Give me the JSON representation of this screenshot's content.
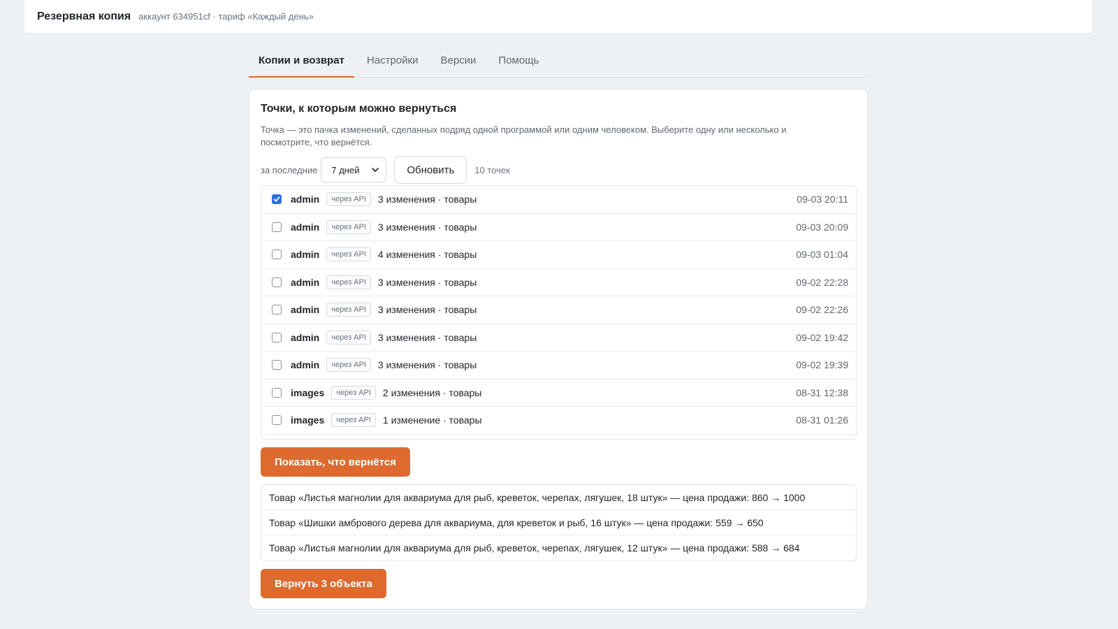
{
  "header": {
    "title": "Резервная копия",
    "subtitle": "аккаунт 634951cf · тариф «Каждый день»"
  },
  "tabs": [
    {
      "label": "Копии и возврат",
      "active": true
    },
    {
      "label": "Настройки",
      "active": false
    },
    {
      "label": "Версии",
      "active": false
    },
    {
      "label": "Помощь",
      "active": false
    }
  ],
  "panel": {
    "title": "Точки, к которым можно вернуться",
    "description": "Точка — это пачка изменений, сделанных подряд одной программой или одним человеком. Выберите одну или несколько и посмотрите, что вернётся.",
    "filter_label": "за последние",
    "period_value": "7 дней",
    "refresh_label": "Обновить",
    "points_count": "10 точек"
  },
  "points": [
    {
      "checked": true,
      "who": "admin",
      "badge": "через API",
      "summary": "3 изменения · товары",
      "time": "09-03 20:11"
    },
    {
      "checked": false,
      "who": "admin",
      "badge": "через API",
      "summary": "3 изменения · товары",
      "time": "09-03 20:09"
    },
    {
      "checked": false,
      "who": "admin",
      "badge": "через API",
      "summary": "4 изменения · товары",
      "time": "09-03 01:04"
    },
    {
      "checked": false,
      "who": "admin",
      "badge": "через API",
      "summary": "3 изменения · товары",
      "time": "09-02 22:28"
    },
    {
      "checked": false,
      "who": "admin",
      "badge": "через API",
      "summary": "3 изменения · товары",
      "time": "09-02 22:26"
    },
    {
      "checked": false,
      "who": "admin",
      "badge": "через API",
      "summary": "3 изменения · товары",
      "time": "09-02 19:42"
    },
    {
      "checked": false,
      "who": "admin",
      "badge": "через API",
      "summary": "3 изменения · товары",
      "time": "09-02 19:39"
    },
    {
      "checked": false,
      "who": "images",
      "badge": "через API",
      "summary": "2 изменения · товары",
      "time": "08-31 12:38"
    },
    {
      "checked": false,
      "who": "images",
      "badge": "через API",
      "summary": "1 изменение · товары",
      "time": "08-31 01:26"
    }
  ],
  "actions": {
    "show_label": "Показать, что вернётся",
    "restore_label": "Вернуть 3 объекта"
  },
  "changes": [
    "Товар «Листья магнолии для аквариума для рыб, креветок, черепах, лягушек, 18 штук» — цена продажи: 860 → 1000",
    "Товар «Шишки амбрового дерева для аквариума, для креветок и рыб, 16 штук» — цена продажи: 559 → 650",
    "Товар «Листья магнолии для аквариума для рыб, креветок, черепах, лягушек, 12 штук» — цена продажи: 588 → 684"
  ],
  "colors": {
    "accent": "#de6a2f",
    "checkbox": "#2f6fe4",
    "background": "#eef1f4"
  }
}
